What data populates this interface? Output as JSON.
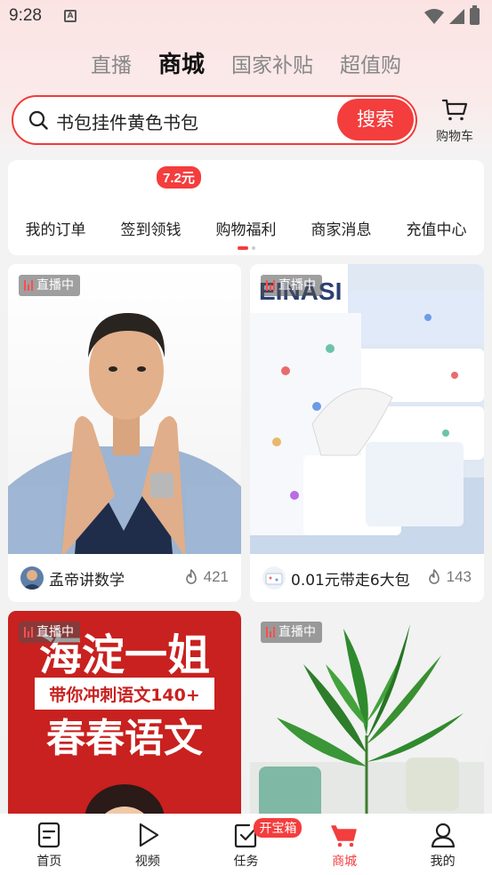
{
  "status_bar": {
    "time": "9:28",
    "app_icon_letter": "A"
  },
  "top_tabs": [
    {
      "label": "直播",
      "active": false
    },
    {
      "label": "商城",
      "active": true
    },
    {
      "label": "国家补贴",
      "active": false
    },
    {
      "label": "超值购",
      "active": false
    }
  ],
  "search": {
    "query": "书包挂件黄色书包",
    "button_label": "搜索"
  },
  "cart": {
    "label": "购物车"
  },
  "quick_menu": {
    "badge": "7.2元",
    "items": [
      "我的订单",
      "签到领钱",
      "购物福利",
      "商家消息",
      "充值中心"
    ],
    "page_index": 0,
    "page_count": 2
  },
  "feed": [
    {
      "live_label": "直播中",
      "name": "孟帝讲数学",
      "likes": "421",
      "image_text": ""
    },
    {
      "live_label": "直播中",
      "name": "0.01元带走6大包",
      "likes": "143",
      "image_text": "EINASI"
    },
    {
      "live_label": "直播中",
      "name": "",
      "likes": "",
      "image_text": "海淀一姐",
      "image_subtext": "带你冲刺语文140+",
      "image_text2": "春春语文"
    },
    {
      "live_label": "直播中",
      "name": "",
      "likes": "",
      "image_text": ""
    }
  ],
  "bottom_nav": {
    "items": [
      {
        "label": "首页",
        "icon": "home-doc-icon"
      },
      {
        "label": "视频",
        "icon": "play-icon"
      },
      {
        "label": "任务",
        "icon": "task-check-icon",
        "badge": "开宝箱"
      },
      {
        "label": "商城",
        "icon": "cart-icon",
        "active": true
      },
      {
        "label": "我的",
        "icon": "person-icon"
      }
    ]
  },
  "colors": {
    "accent": "#f43d3d",
    "live_bar": "#ff4d4d"
  }
}
